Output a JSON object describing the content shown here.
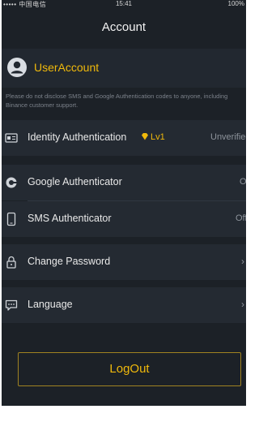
{
  "status_bar": {
    "carrier": "••••• 中国电信",
    "time": "15:41",
    "battery": "100%"
  },
  "nav": {
    "title": "Account"
  },
  "user": {
    "name": "UserAccount"
  },
  "notice": "Please do not disclose SMS and Google Authentication codes to anyone, including Binance customer support.",
  "menu": {
    "identity": {
      "label": "Identity Authentication",
      "level": "Lv1",
      "status": "Unverified"
    },
    "google": {
      "label": "Google Authenticator",
      "status": "Off"
    },
    "sms": {
      "label": "SMS Authenticator",
      "status": "Off"
    },
    "password": {
      "label": "Change Password"
    },
    "language": {
      "label": "Language"
    }
  },
  "logout": {
    "label": "LogOut"
  },
  "colors": {
    "accent": "#f0b90b",
    "background": "#1c2127",
    "row": "#242a32"
  },
  "icons": [
    "avatar-icon",
    "id-card-icon",
    "google-icon",
    "phone-icon",
    "lock-icon",
    "message-icon",
    "diamond-icon",
    "chevron-right-icon",
    "wifi-icon"
  ]
}
